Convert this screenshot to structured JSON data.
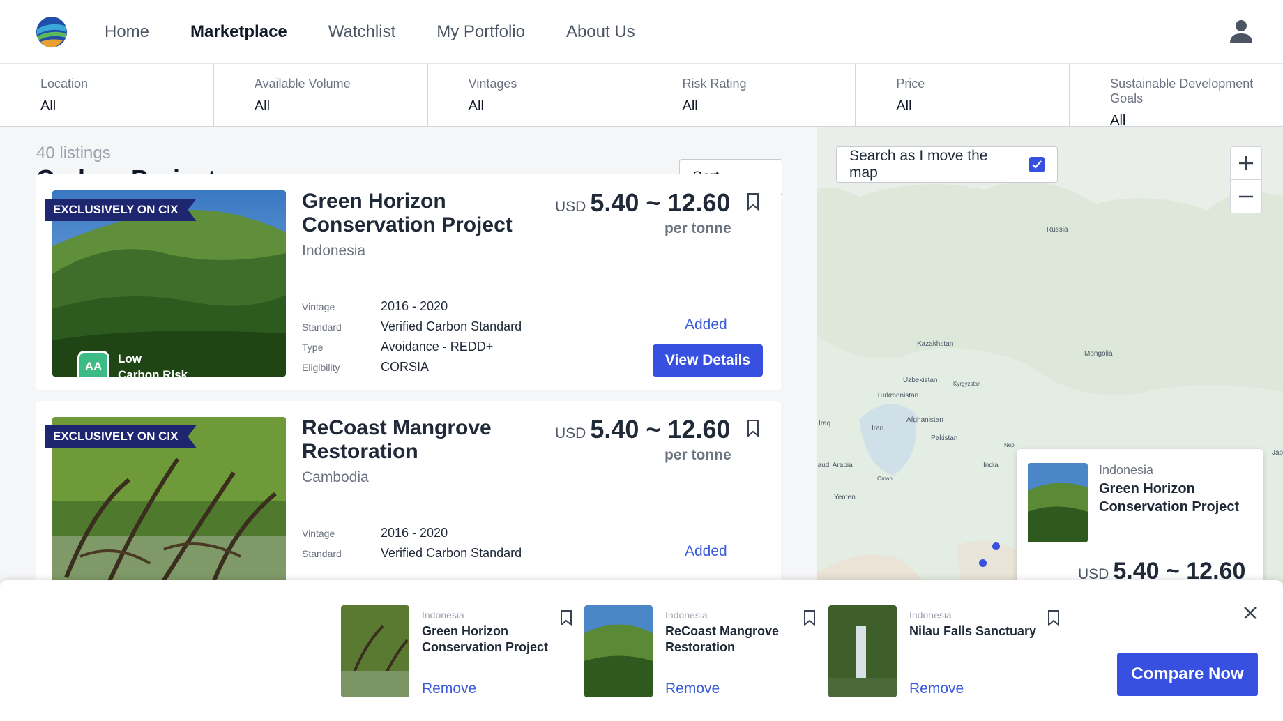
{
  "nav": {
    "links": [
      "Home",
      "Marketplace",
      "Watchlist",
      "My Portfolio",
      "About Us"
    ],
    "active": "Marketplace"
  },
  "filters": [
    {
      "label": "Location",
      "value": "All"
    },
    {
      "label": "Available Volume",
      "value": "All"
    },
    {
      "label": "Vintages",
      "value": "All"
    },
    {
      "label": "Risk Rating",
      "value": "All"
    },
    {
      "label": "Price",
      "value": "All"
    },
    {
      "label": "Sustainable Development Goals",
      "value": "All"
    }
  ],
  "list": {
    "count": "40 listings",
    "title": "Carbon Projects",
    "sort_label": "Sort"
  },
  "cards": [
    {
      "ribbon": "EXCLUSIVELY ON CIX",
      "risk_badge": "AA",
      "risk_line1": "Low",
      "risk_line2": "Carbon Risk",
      "name": "Green Horizon Conservation Project",
      "country": "Indonesia",
      "currency": "USD",
      "price": "5.40 ~ 12.60",
      "per": "per tonne",
      "specs": [
        {
          "k": "Vintage",
          "v": "2016 - 2020"
        },
        {
          "k": "Standard",
          "v": "Verified Carbon Standard"
        },
        {
          "k": "Type",
          "v": "Avoidance - REDD+"
        },
        {
          "k": "Eligibility",
          "v": "CORSIA"
        }
      ],
      "added": "Added",
      "view": "View Details"
    },
    {
      "ribbon": "EXCLUSIVELY ON CIX",
      "name": "ReCoast Mangrove Restoration",
      "country": "Cambodia",
      "currency": "USD",
      "price": "5.40 ~ 12.60",
      "per": "per tonne",
      "specs": [
        {
          "k": "Vintage",
          "v": "2016 - 2020"
        },
        {
          "k": "Standard",
          "v": "Verified Carbon Standard"
        }
      ],
      "added": "Added"
    }
  ],
  "map": {
    "search_toggle": "Search as I move the map",
    "labels": [
      "Russia",
      "Kazakhstan",
      "Mongolia",
      "Uzbekistan",
      "Kyrgyzstan",
      "Turkmenistan",
      "Afghanistan",
      "Iraq",
      "Iran",
      "Pakistan",
      "Nepal",
      "India",
      "Saudi Arabia",
      "Oman",
      "Yemen",
      "Japan"
    ],
    "popup": {
      "country": "Indonesia",
      "name": "Green Horizon Conservation Project",
      "currency": "USD",
      "price": "5.40 ~ 12.60"
    }
  },
  "compare": {
    "items": [
      {
        "country": "Indonesia",
        "name": "Green Horizon Conservation Project",
        "remove": "Remove"
      },
      {
        "country": "Indonesia",
        "name": "ReCoast Mangrove Restoration",
        "remove": "Remove"
      },
      {
        "country": "Indonesia",
        "name": "Nilau Falls Sanctuary",
        "remove": "Remove"
      }
    ],
    "button": "Compare Now"
  },
  "colors": {
    "primary": "#3750e0",
    "ribbon": "#1e2670",
    "risk_green": "#3dbb86",
    "link": "#3b5bdb"
  }
}
